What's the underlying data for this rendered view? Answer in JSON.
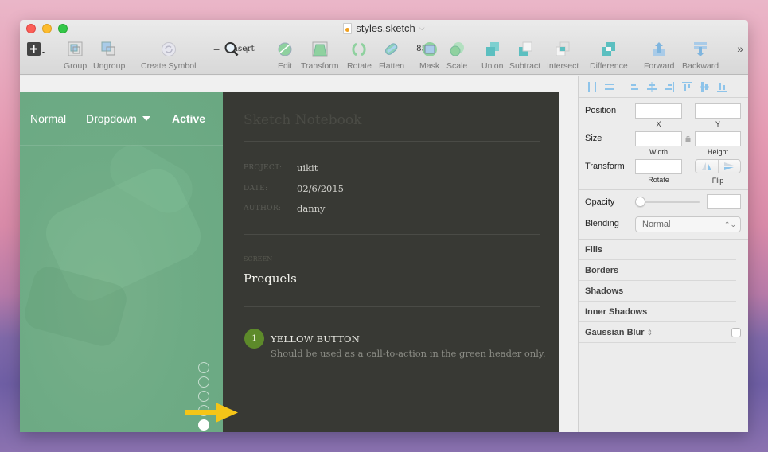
{
  "window": {
    "title": "styles.sketch",
    "title_icon": "sketch-document-icon",
    "title_menu_icon": "chevron-down-icon"
  },
  "toolbar": {
    "insert": {
      "label": "Insert",
      "icon": "plus-square-icon"
    },
    "group": {
      "label": "Group",
      "icon": "group-icon"
    },
    "ungroup": {
      "label": "Ungroup",
      "icon": "ungroup-icon"
    },
    "create_symbol": {
      "label": "Create Symbol",
      "icon": "symbol-icon"
    },
    "zoom": {
      "label": "85%",
      "minus": "−",
      "plus": "+",
      "icon": "magnifier-icon"
    },
    "edit": {
      "label": "Edit"
    },
    "transform": {
      "label": "Transform"
    },
    "rotate": {
      "label": "Rotate"
    },
    "flatten": {
      "label": "Flatten"
    },
    "mask": {
      "label": "Mask"
    },
    "scale": {
      "label": "Scale"
    },
    "union": {
      "label": "Union"
    },
    "subtract": {
      "label": "Subtract"
    },
    "intersect": {
      "label": "Intersect"
    },
    "difference": {
      "label": "Difference"
    },
    "forward": {
      "label": "Forward"
    },
    "backward": {
      "label": "Backward"
    },
    "more": "»"
  },
  "artboard": {
    "nav": {
      "normal": "Normal",
      "dropdown": "Dropdown",
      "active": "Active"
    },
    "pager": {
      "total": 5,
      "active_index": 5
    },
    "notebook": {
      "title": "Sketch Notebook",
      "meta": [
        {
          "key": "PROJECT:",
          "value": "uikit"
        },
        {
          "key": "DATE:",
          "value": "02/6/2015"
        },
        {
          "key": "AUTHOR:",
          "value": "danny"
        }
      ],
      "screen_label": "SCREEN",
      "screen_name": "Prequels",
      "item": {
        "number": "1",
        "title": "YELLOW BUTTON",
        "description": "Should be used as a call-to-action in the green header only."
      }
    },
    "colors": {
      "green": "#6eab85",
      "dark": "#383934",
      "badge": "#5d8a2a",
      "arrow": "#f5c518"
    }
  },
  "inspector": {
    "position_label": "Position",
    "x_label": "X",
    "y_label": "Y",
    "x_value": "",
    "y_value": "",
    "size_label": "Size",
    "width_label": "Width",
    "height_label": "Height",
    "width_value": "",
    "height_value": "",
    "transform_label": "Transform",
    "rotate_label": "Rotate",
    "rotate_value": "",
    "flip_label": "Flip",
    "opacity_label": "Opacity",
    "opacity_value": "",
    "opacity_level": 0,
    "blending_label": "Blending",
    "blending_value": "Normal",
    "sections": [
      "Fills",
      "Borders",
      "Shadows",
      "Inner Shadows",
      "Gaussian Blur"
    ],
    "gaussian_enabled": false
  }
}
